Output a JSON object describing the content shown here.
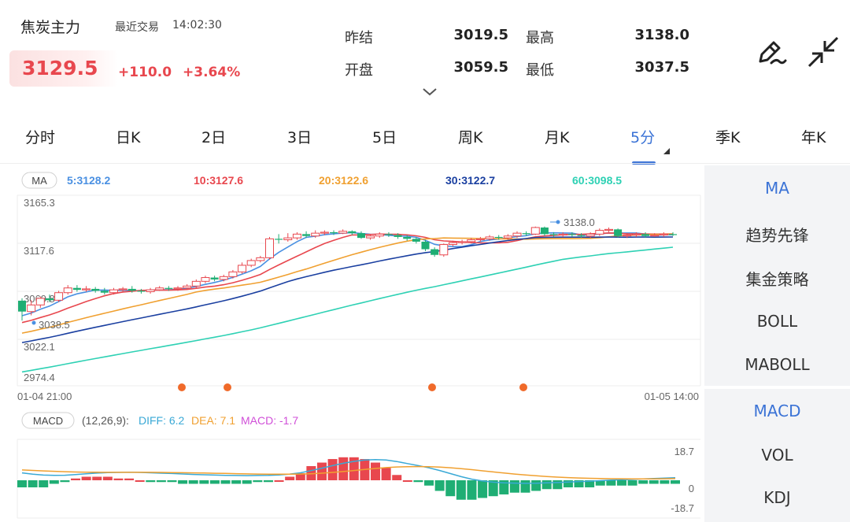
{
  "header": {
    "title": "焦炭主力",
    "recent_label": "最近交易",
    "time": "14:02:30",
    "price": "3129.5",
    "change": "+110.0",
    "change_pct": "+3.64%",
    "stats": [
      {
        "label": "昨结",
        "value": "3019.5"
      },
      {
        "label": "开盘",
        "value": "3059.5"
      },
      {
        "label": "最高",
        "value": "3138.0"
      },
      {
        "label": "最低",
        "value": "3037.5"
      }
    ]
  },
  "tabs": [
    "分时",
    "日K",
    "2日",
    "3日",
    "5日",
    "周K",
    "月K",
    "5分",
    "季K",
    "年K"
  ],
  "active_tab": "5分",
  "ma_legend": {
    "tag": "MA",
    "items": [
      {
        "text": "5:3128.2",
        "color": "#4a90e2"
      },
      {
        "text": "10:3127.6",
        "color": "#e8474e"
      },
      {
        "text": "20:3122.6",
        "color": "#f0a030"
      },
      {
        "text": "30:3122.7",
        "color": "#1a3fa0"
      },
      {
        "text": "60:3098.5",
        "color": "#2ed1b4"
      }
    ]
  },
  "price_axis": [
    "3165.3",
    "3117.6",
    "3069.8",
    "3022.1",
    "2974.4"
  ],
  "annotations": {
    "high": "3138.0",
    "low": "3038.5"
  },
  "time_axis": {
    "start": "01-04 21:00",
    "end": "01-05 14:00"
  },
  "macd_legend": {
    "tag": "MACD",
    "params": "(12,26,9):",
    "diff": "DIFF: 6.2",
    "dea": "DEA: 7.1",
    "macd": "MACD: -1.7"
  },
  "macd_axis": [
    "18.7",
    "0",
    "-18.7"
  ],
  "side_top": [
    "MA",
    "趋势先锋",
    "集金策略",
    "BOLL",
    "MABOLL"
  ],
  "side_bottom": [
    "MACD",
    "VOL",
    "KDJ"
  ],
  "colors": {
    "up": "#e8474e",
    "down": "#1fae74",
    "accent": "#3b73d6"
  },
  "icons": [
    "edit-pen-icon",
    "collapse-arrows-icon",
    "chevron-down-icon"
  ],
  "chart_data": {
    "type": "candlestick",
    "price_range": [
      2974.4,
      3165.3
    ],
    "candles": [
      [
        3059.5,
        3048,
        3062,
        3038.5
      ],
      [
        3048,
        3055,
        3060,
        3044
      ],
      [
        3055,
        3062,
        3064,
        3052
      ],
      [
        3062,
        3060,
        3066,
        3058
      ],
      [
        3060,
        3068,
        3070,
        3058
      ],
      [
        3068,
        3073,
        3076,
        3066
      ],
      [
        3073,
        3071,
        3076,
        3069
      ],
      [
        3071,
        3072,
        3075,
        3069
      ],
      [
        3072,
        3070,
        3074,
        3068
      ],
      [
        3070,
        3068,
        3073,
        3066
      ],
      [
        3068,
        3071,
        3073,
        3066
      ],
      [
        3071,
        3072,
        3074,
        3069
      ],
      [
        3072,
        3070,
        3075,
        3068
      ],
      [
        3070,
        3069,
        3072,
        3067
      ],
      [
        3069,
        3071,
        3073,
        3067
      ],
      [
        3071,
        3073,
        3075,
        3070
      ],
      [
        3073,
        3072,
        3075,
        3070
      ],
      [
        3072,
        3073,
        3075,
        3070
      ],
      [
        3073,
        3075,
        3077,
        3071
      ],
      [
        3075,
        3080,
        3082,
        3073
      ],
      [
        3080,
        3084,
        3086,
        3078
      ],
      [
        3084,
        3082,
        3086,
        3080
      ],
      [
        3082,
        3085,
        3087,
        3080
      ],
      [
        3085,
        3090,
        3092,
        3083
      ],
      [
        3090,
        3097,
        3100,
        3088
      ],
      [
        3097,
        3102,
        3104,
        3095
      ],
      [
        3102,
        3105,
        3107,
        3100
      ],
      [
        3105,
        3125,
        3127,
        3103
      ],
      [
        3125,
        3124,
        3130,
        3120
      ],
      [
        3124,
        3126,
        3131,
        3122
      ],
      [
        3126,
        3130,
        3132,
        3124
      ],
      [
        3130,
        3128,
        3133,
        3126
      ],
      [
        3128,
        3131,
        3134,
        3126
      ],
      [
        3131,
        3132,
        3134,
        3129
      ],
      [
        3132,
        3131,
        3134,
        3129
      ],
      [
        3131,
        3133,
        3135,
        3130
      ],
      [
        3133,
        3131,
        3134,
        3129
      ],
      [
        3131,
        3126,
        3133,
        3125
      ],
      [
        3126,
        3128,
        3130,
        3124
      ],
      [
        3128,
        3130,
        3132,
        3126
      ],
      [
        3130,
        3129,
        3132,
        3127
      ],
      [
        3129,
        3127,
        3131,
        3125
      ],
      [
        3127,
        3125,
        3129,
        3123
      ],
      [
        3125,
        3122,
        3127,
        3120
      ],
      [
        3122,
        3114,
        3124,
        3112
      ],
      [
        3114,
        3108,
        3116,
        3106
      ],
      [
        3108,
        3119,
        3120,
        3106
      ],
      [
        3119,
        3121,
        3123,
        3117
      ],
      [
        3121,
        3122,
        3124,
        3119
      ],
      [
        3122,
        3124,
        3126,
        3120
      ],
      [
        3124,
        3125,
        3127,
        3122
      ],
      [
        3125,
        3127,
        3129,
        3123
      ],
      [
        3127,
        3126,
        3129,
        3124
      ],
      [
        3126,
        3128,
        3130,
        3124
      ],
      [
        3128,
        3131,
        3133,
        3126
      ],
      [
        3131,
        3130,
        3133,
        3128
      ],
      [
        3130,
        3137,
        3138,
        3129
      ],
      [
        3137,
        3130,
        3138,
        3128
      ],
      [
        3130,
        3129,
        3132,
        3127
      ],
      [
        3129,
        3130,
        3132,
        3127
      ],
      [
        3130,
        3129,
        3132,
        3127
      ],
      [
        3129,
        3128,
        3131,
        3126
      ],
      [
        3128,
        3130,
        3132,
        3126
      ],
      [
        3130,
        3134,
        3136,
        3128
      ],
      [
        3134,
        3135,
        3137,
        3132
      ],
      [
        3135,
        3128,
        3136,
        3126
      ],
      [
        3128,
        3129,
        3131,
        3126
      ],
      [
        3129,
        3130,
        3132,
        3127
      ],
      [
        3130,
        3128,
        3132,
        3126
      ],
      [
        3128,
        3129,
        3131,
        3127
      ],
      [
        3129,
        3130,
        3132,
        3127
      ],
      [
        3130,
        3129.5,
        3132,
        3128
      ]
    ],
    "macd_range": [
      -18.7,
      18.7
    ],
    "macd_hist": [
      -4,
      -4,
      -4,
      -2,
      -1,
      1,
      2,
      2,
      2,
      1,
      1,
      0,
      -1,
      -1,
      -1,
      -2,
      -2,
      -2,
      -2,
      -2,
      -2,
      -2,
      -1,
      -1,
      0,
      2,
      4,
      8,
      10,
      12,
      13,
      13,
      12,
      10,
      7,
      3,
      0,
      -1,
      -3,
      -6,
      -9,
      -11,
      -11,
      -10,
      -9,
      -8,
      -7,
      -7,
      -6,
      -5,
      -5,
      -4,
      -4,
      -4,
      -3,
      -3,
      -3,
      -3,
      -2,
      -2,
      -2,
      -2
    ],
    "signal_markers": [
      "dot",
      "dot",
      "dot",
      "dot"
    ]
  }
}
